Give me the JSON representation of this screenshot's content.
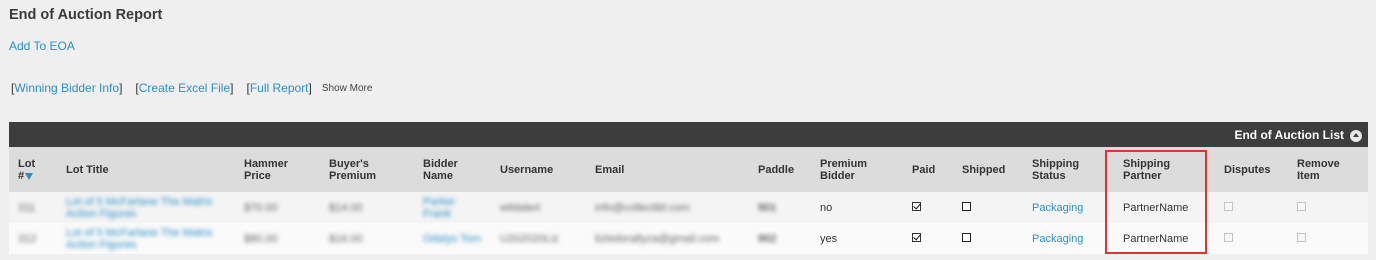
{
  "page": {
    "title": "End of Auction Report",
    "add_link": "Add To EOA"
  },
  "actions": {
    "winning_bidder": "Winning Bidder Info",
    "create_excel": "Create Excel File",
    "full_report": "Full Report",
    "show_more": "Show More"
  },
  "panel": {
    "title": "End of Auction List"
  },
  "table": {
    "headers": {
      "lot": [
        "Lot",
        "#"
      ],
      "lot_title": "Lot Title",
      "hammer": [
        "Hammer",
        "Price"
      ],
      "premium": [
        "Buyer's",
        "Premium"
      ],
      "bidder": [
        "Bidder",
        "Name"
      ],
      "username": "Username",
      "email": "Email",
      "paddle": "Paddle",
      "premium_bidder": [
        "Premium",
        "Bidder"
      ],
      "paid": "Paid",
      "shipped": "Shipped",
      "ship_status": [
        "Shipping",
        "Status"
      ],
      "ship_partner": [
        "Shipping",
        "Partner"
      ],
      "disputes": "Disputes",
      "remove": [
        "Remove",
        "Item"
      ]
    },
    "rows": [
      {
        "lot": "311",
        "lot_title": [
          "Lot of 5 McFarlane The Matrix",
          "Action Figures"
        ],
        "hammer": "$70.00",
        "premium": "$14.00",
        "bidder": [
          "Parker",
          "Frank"
        ],
        "username": "wildalert",
        "email": "info@collectibl.com",
        "paddle": "901",
        "premium_bidder": "no",
        "ship_status": "Packaging",
        "ship_partner": "PartnerName"
      },
      {
        "lot": "312",
        "lot_title": [
          "Lot of 5 McFarlane The Matrix",
          "Action Figures"
        ],
        "hammer": "$80.00",
        "premium": "$16.00",
        "bidder": [
          "Odalys Tom"
        ],
        "username": "U202020Liz",
        "email": "lizbidorallyza@gmail.com",
        "paddle": "902",
        "premium_bidder": "yes",
        "ship_status": "Packaging",
        "ship_partner": "PartnerName"
      }
    ]
  },
  "colors": {
    "link": "#2a8fc7",
    "header_bar": "#3d3d3d",
    "highlight": "#e53030"
  }
}
